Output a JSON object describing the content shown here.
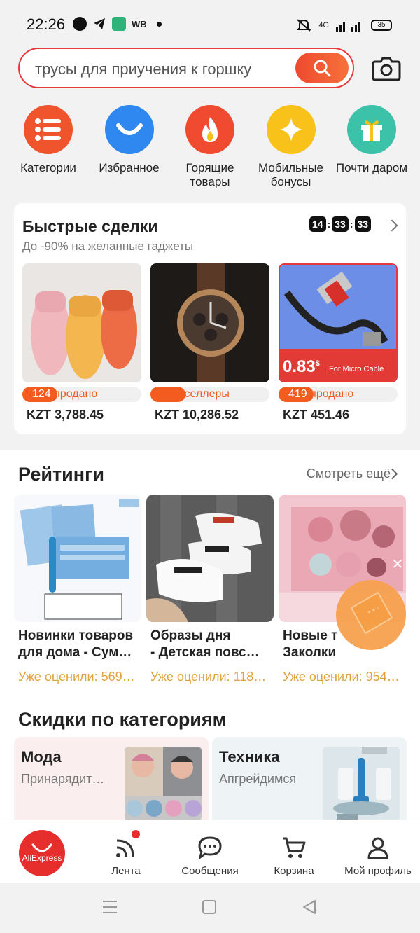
{
  "status_bar": {
    "time": "22:26",
    "carrier_tag": "WB",
    "network": "4G",
    "battery": "35"
  },
  "search": {
    "query": "трусы для приучения к горшку"
  },
  "quick_links": [
    {
      "label": "Категории",
      "color": "#f0542c"
    },
    {
      "label": "Избранное",
      "color": "#2f88ef"
    },
    {
      "label": "Горящие товары",
      "color": "#f04a30"
    },
    {
      "label": "Мобильные бонусы",
      "color": "#f8c21a"
    },
    {
      "label": "Почти даром",
      "color": "#3cc2a9"
    }
  ],
  "flash_deals": {
    "title": "Быстрые сделки",
    "subtitle": "До -90% на желанные гаджеты",
    "timer": [
      "14",
      "33",
      "33"
    ],
    "items": [
      {
        "badge_count": "124",
        "badge_text": "продано",
        "price": "KZT 3,788.45"
      },
      {
        "badge_count": "",
        "badge_text": "Бестселлеры",
        "price": "KZT 10,286.52"
      },
      {
        "badge_count": "419",
        "badge_text": "продано",
        "price": "KZT 451.46"
      }
    ],
    "cable_promo": {
      "price": "0.83",
      "currency": "$",
      "caption": "For Micro Cable"
    }
  },
  "ratings": {
    "title": "Рейтинги",
    "see_more": "Смотреть ещё",
    "items": [
      {
        "name_line1": "Новинки товаров",
        "name_line2": "для дома - Сум…",
        "sub": "Уже оценили: 569…"
      },
      {
        "name_line1": "Образы дня",
        "name_line2": "- Детская повс…",
        "sub": "Уже оценили: 118…"
      },
      {
        "name_line1": "Новые т",
        "name_line2": "Заколки",
        "sub": "Уже оценили: 954…"
      }
    ]
  },
  "category_discounts": {
    "title": "Скидки по категориям",
    "items": [
      {
        "name": "Мода",
        "sub": "Принарядит…",
        "bg": "#fbeeee"
      },
      {
        "name": "Техника",
        "sub": "Апгрейдимся",
        "bg": "#eef3f6"
      }
    ]
  },
  "bottom_nav": {
    "logo": "AliExpress",
    "items": [
      "Лента",
      "Сообщения",
      "Корзина",
      "Мой профиль"
    ]
  },
  "accent_color": "#e6393d"
}
